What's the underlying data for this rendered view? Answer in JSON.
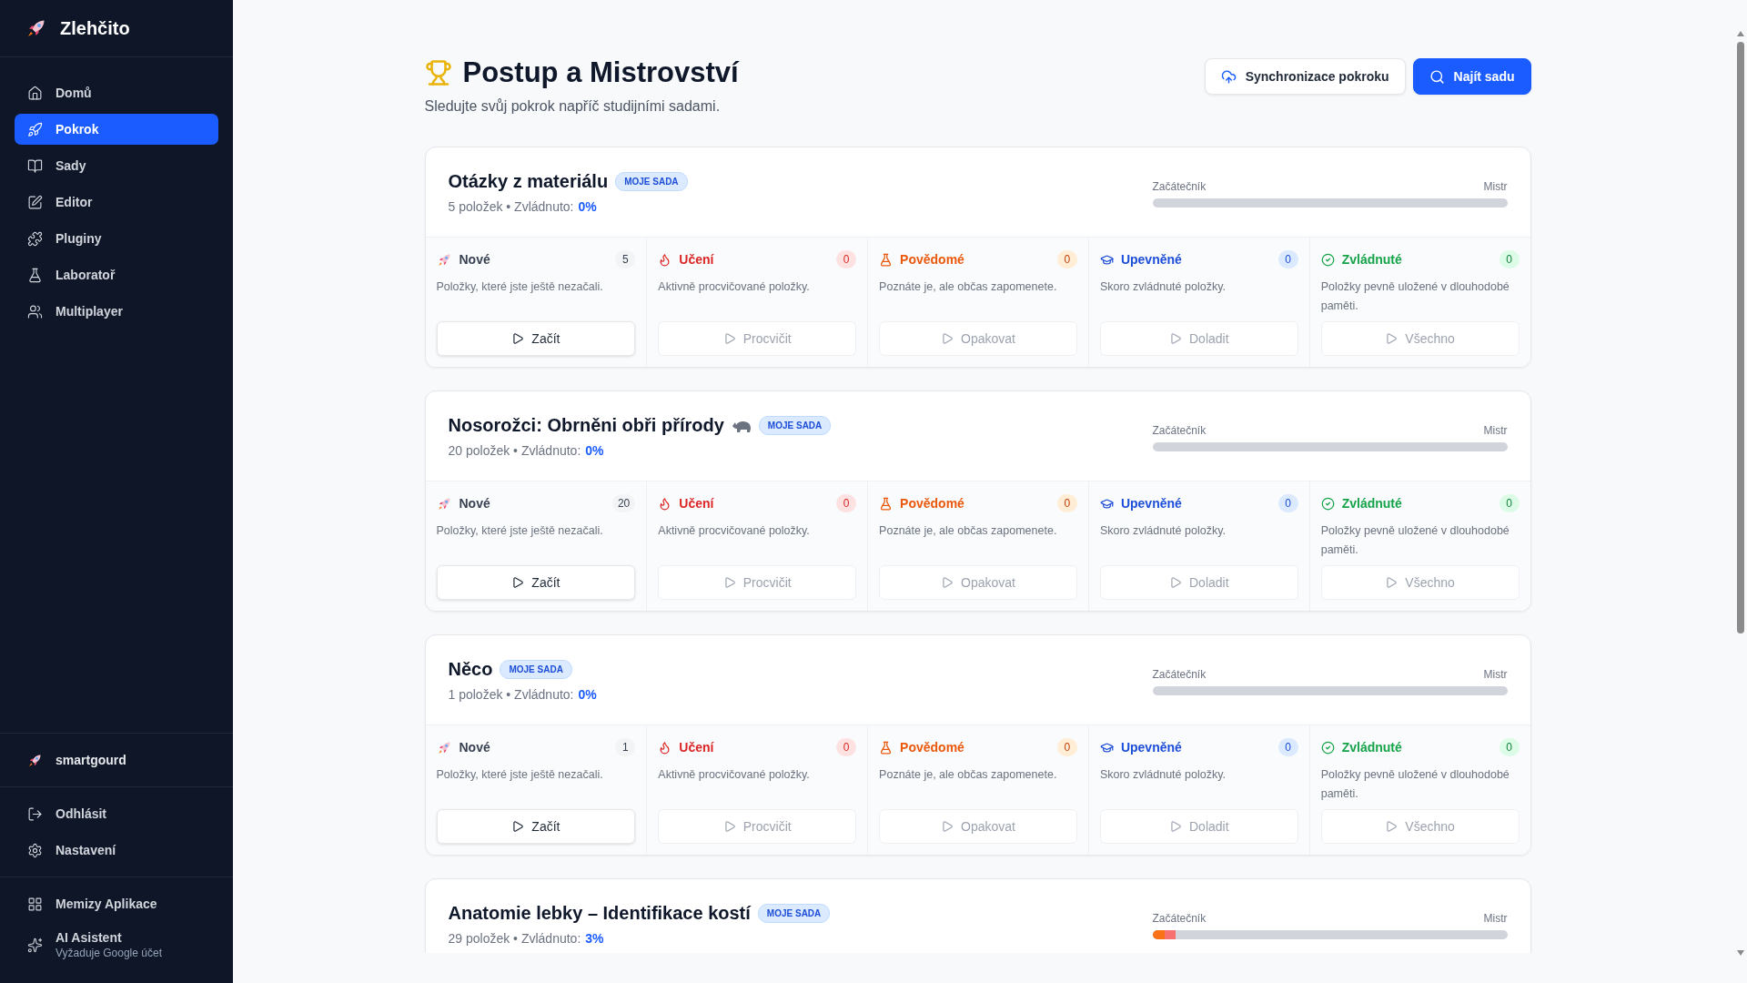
{
  "sidebar": {
    "logo": "Zlehčito",
    "nav": [
      {
        "label": "Domů",
        "selected": false
      },
      {
        "label": "Pokrok",
        "selected": true
      },
      {
        "label": "Sady",
        "selected": false
      },
      {
        "label": "Editor",
        "selected": false
      },
      {
        "label": "Pluginy",
        "selected": false
      },
      {
        "label": "Laboratoř",
        "selected": false
      },
      {
        "label": "Multiplayer",
        "selected": false
      }
    ],
    "user": "smartgourd",
    "account": [
      {
        "label": "Odhlásit"
      },
      {
        "label": "Nastavení"
      }
    ],
    "apps": [
      {
        "label": "Memizy Aplikace"
      },
      {
        "label": "AI Asistent",
        "note": "Vyžaduje Google účet"
      }
    ]
  },
  "header": {
    "title": "Postup a Mistrovství",
    "subtitle": "Sledujte svůj pokrok napříč studijními sadami.",
    "sync_button": "Synchronizace pokroku",
    "find_button": "Najít sadu"
  },
  "sets": [
    {
      "title": "Otázky z materiálu",
      "badge": "MOJE SADA",
      "meta": "5 položek • Zvládnuto:",
      "mastered": "0%",
      "start_label": "Začátečník",
      "end_label": "Mistr",
      "stages": [
        {
          "kind": "new",
          "label": "Nové",
          "count": "5",
          "description": "Položky, které jste ještě nezačali.",
          "button": "Začít",
          "disabled": false
        },
        {
          "kind": "learning",
          "label": "Učení",
          "count": "0",
          "description": "Aktivně procvičované položky.",
          "button": "Procvičit",
          "disabled": true
        },
        {
          "kind": "familiar",
          "label": "Povědomé",
          "count": "0",
          "description": "Poznáte je, ale občas zapomenete.",
          "button": "Opakovat",
          "disabled": true
        },
        {
          "kind": "consolidated",
          "label": "Upevněné",
          "count": "0",
          "description": "Skoro zvládnuté položky.",
          "button": "Doladit",
          "disabled": true
        },
        {
          "kind": "mastered",
          "label": "Zvládnuté",
          "count": "0",
          "description": "Položky pevně uložené v dlouhodobé paměti.",
          "button": "Všechno",
          "disabled": true
        }
      ]
    },
    {
      "title": "Nosorožci: Obrněni obři přírody",
      "title_icon": true,
      "badge": "MOJE SADA",
      "meta": "20 položek • Zvládnuto:",
      "mastered": "0%",
      "start_label": "Začátečník",
      "end_label": "Mistr",
      "stages": [
        {
          "kind": "new",
          "label": "Nové",
          "count": "20",
          "description": "Položky, které jste ještě nezačali.",
          "button": "Začít",
          "disabled": false
        },
        {
          "kind": "learning",
          "label": "Učení",
          "count": "0",
          "description": "Aktivně procvičované položky.",
          "button": "Procvičit",
          "disabled": true
        },
        {
          "kind": "familiar",
          "label": "Povědomé",
          "count": "0",
          "description": "Poznáte je, ale občas zapomenete.",
          "button": "Opakovat",
          "disabled": true
        },
        {
          "kind": "consolidated",
          "label": "Upevněné",
          "count": "0",
          "description": "Skoro zvládnuté položky.",
          "button": "Doladit",
          "disabled": true
        },
        {
          "kind": "mastered",
          "label": "Zvládnuté",
          "count": "0",
          "description": "Položky pevně uložené v dlouhodobé paměti.",
          "button": "Všechno",
          "disabled": true
        }
      ]
    },
    {
      "title": "Něco",
      "badge": "MOJE SADA",
      "meta": "1 položek • Zvládnuto:",
      "mastered": "0%",
      "start_label": "Začátečník",
      "end_label": "Mistr",
      "stages": [
        {
          "kind": "new",
          "label": "Nové",
          "count": "1",
          "description": "Položky, které jste ještě nezačali.",
          "button": "Začít",
          "disabled": false
        },
        {
          "kind": "learning",
          "label": "Učení",
          "count": "0",
          "description": "Aktivně procvičované položky.",
          "button": "Procvičit",
          "disabled": true
        },
        {
          "kind": "familiar",
          "label": "Povědomé",
          "count": "0",
          "description": "Poznáte je, ale občas zapomenete.",
          "button": "Opakovat",
          "disabled": true
        },
        {
          "kind": "consolidated",
          "label": "Upevněné",
          "count": "0",
          "description": "Skoro zvládnuté položky.",
          "button": "Doladit",
          "disabled": true
        },
        {
          "kind": "mastered",
          "label": "Zvládnuté",
          "count": "0",
          "description": "Položky pevně uložené v dlouhodobé paměti.",
          "button": "Všechno",
          "disabled": true
        }
      ]
    },
    {
      "title": "Anatomie lebky – Identifikace kostí",
      "badge": "MOJE SADA",
      "meta": "29 položek • Zvládnuto:",
      "mastered": "3%",
      "start_label": "Začátečník",
      "end_label": "Mistr",
      "progress": [
        {
          "kind": "familiar",
          "level": 0.035
        },
        {
          "kind": "learning",
          "level": 0.03
        }
      ]
    }
  ]
}
